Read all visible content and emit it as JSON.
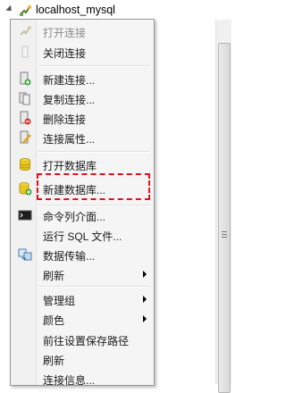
{
  "tree": {
    "connection_name": "localhost_mysql"
  },
  "menu": {
    "items": [
      {
        "label": "打开连接",
        "icon": "open-connection-icon",
        "disabled": true
      },
      {
        "label": "关闭连接",
        "icon": "close-connection-icon",
        "disabled": false
      },
      {
        "label": "新建连接...",
        "icon": "new-connection-icon"
      },
      {
        "label": "复制连接...",
        "icon": "copy-connection-icon"
      },
      {
        "label": "删除连接",
        "icon": "delete-connection-icon"
      },
      {
        "label": "连接属性...",
        "icon": "connection-properties-icon"
      },
      {
        "label": "打开数据库",
        "icon": "open-database-icon"
      },
      {
        "label": "新建数据库...",
        "icon": "new-database-icon"
      },
      {
        "label": "命令列介面...",
        "icon": "console-icon"
      },
      {
        "label": "运行 SQL 文件...",
        "icon": ""
      },
      {
        "label": "数据传输...",
        "icon": "data-transfer-icon"
      },
      {
        "label": "刷新",
        "icon": "",
        "submenu": true
      },
      {
        "label": "管理组",
        "icon": "",
        "submenu": true
      },
      {
        "label": "颜色",
        "icon": "",
        "submenu": true
      },
      {
        "label": "前往设置保存路径",
        "icon": ""
      },
      {
        "label": "刷新",
        "icon": ""
      },
      {
        "label": "连接信息...",
        "icon": ""
      }
    ]
  },
  "colors": {
    "highlight": "#e0131c"
  }
}
